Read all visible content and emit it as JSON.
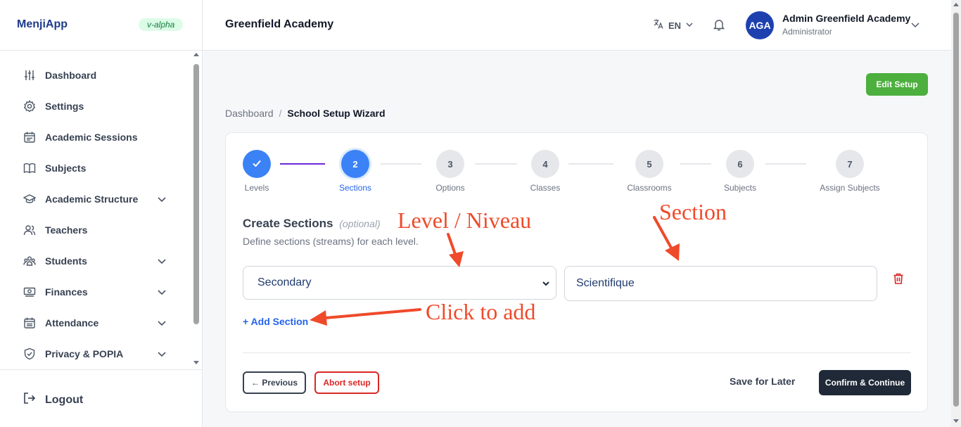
{
  "sidebar": {
    "brand": "MenjiApp",
    "version": "v-alpha",
    "items": [
      {
        "label": "Dashboard",
        "icon": "sliders-icon",
        "expandable": false
      },
      {
        "label": "Settings",
        "icon": "gear-icon",
        "expandable": false
      },
      {
        "label": "Academic Sessions",
        "icon": "calendar-icon",
        "expandable": false
      },
      {
        "label": "Subjects",
        "icon": "book-icon",
        "expandable": false
      },
      {
        "label": "Academic Structure",
        "icon": "graduation-cap-icon",
        "expandable": true
      },
      {
        "label": "Teachers",
        "icon": "users-icon",
        "expandable": false
      },
      {
        "label": "Students",
        "icon": "group-icon",
        "expandable": true
      },
      {
        "label": "Finances",
        "icon": "banknote-icon",
        "expandable": true
      },
      {
        "label": "Attendance",
        "icon": "calendar-check-icon",
        "expandable": true
      },
      {
        "label": "Privacy & POPIA",
        "icon": "shield-icon",
        "expandable": true
      }
    ],
    "logout": "Logout"
  },
  "header": {
    "school": "Greenfield Academy",
    "language": "EN",
    "user": {
      "initials": "AGA",
      "name": "Admin Greenfield Academy",
      "role": "Administrator"
    }
  },
  "main": {
    "edit_setup": "Edit Setup",
    "breadcrumb": {
      "root": "Dashboard",
      "separator": "/",
      "current": "School Setup Wizard"
    },
    "steps": [
      {
        "number": "",
        "label": "Levels",
        "state": "done"
      },
      {
        "number": "2",
        "label": "Sections",
        "state": "active"
      },
      {
        "number": "3",
        "label": "Options",
        "state": "todo"
      },
      {
        "number": "4",
        "label": "Classes",
        "state": "todo"
      },
      {
        "number": "5",
        "label": "Classrooms",
        "state": "todo"
      },
      {
        "number": "6",
        "label": "Subjects",
        "state": "todo"
      },
      {
        "number": "7",
        "label": "Assign Subjects",
        "state": "todo"
      }
    ],
    "section_title": "Create Sections",
    "section_optional": "(optional)",
    "section_desc": "Define sections (streams) for each level.",
    "level_value": "Secondary",
    "section_value": "Scientifique",
    "add_section": "+ Add Section",
    "previous": "← Previous",
    "abort": "Abort setup",
    "save_later": "Save for Later",
    "confirm": "Confirm & Continue"
  },
  "annotations": {
    "level": "Level / Niveau",
    "section": "Section",
    "add": "Click to add"
  },
  "colors": {
    "primary": "#3b82f6",
    "brand": "#1e3a8a",
    "success": "#4caf3e",
    "danger": "#dc2626",
    "annotation": "#ef4a2a",
    "dark": "#1f2937"
  }
}
